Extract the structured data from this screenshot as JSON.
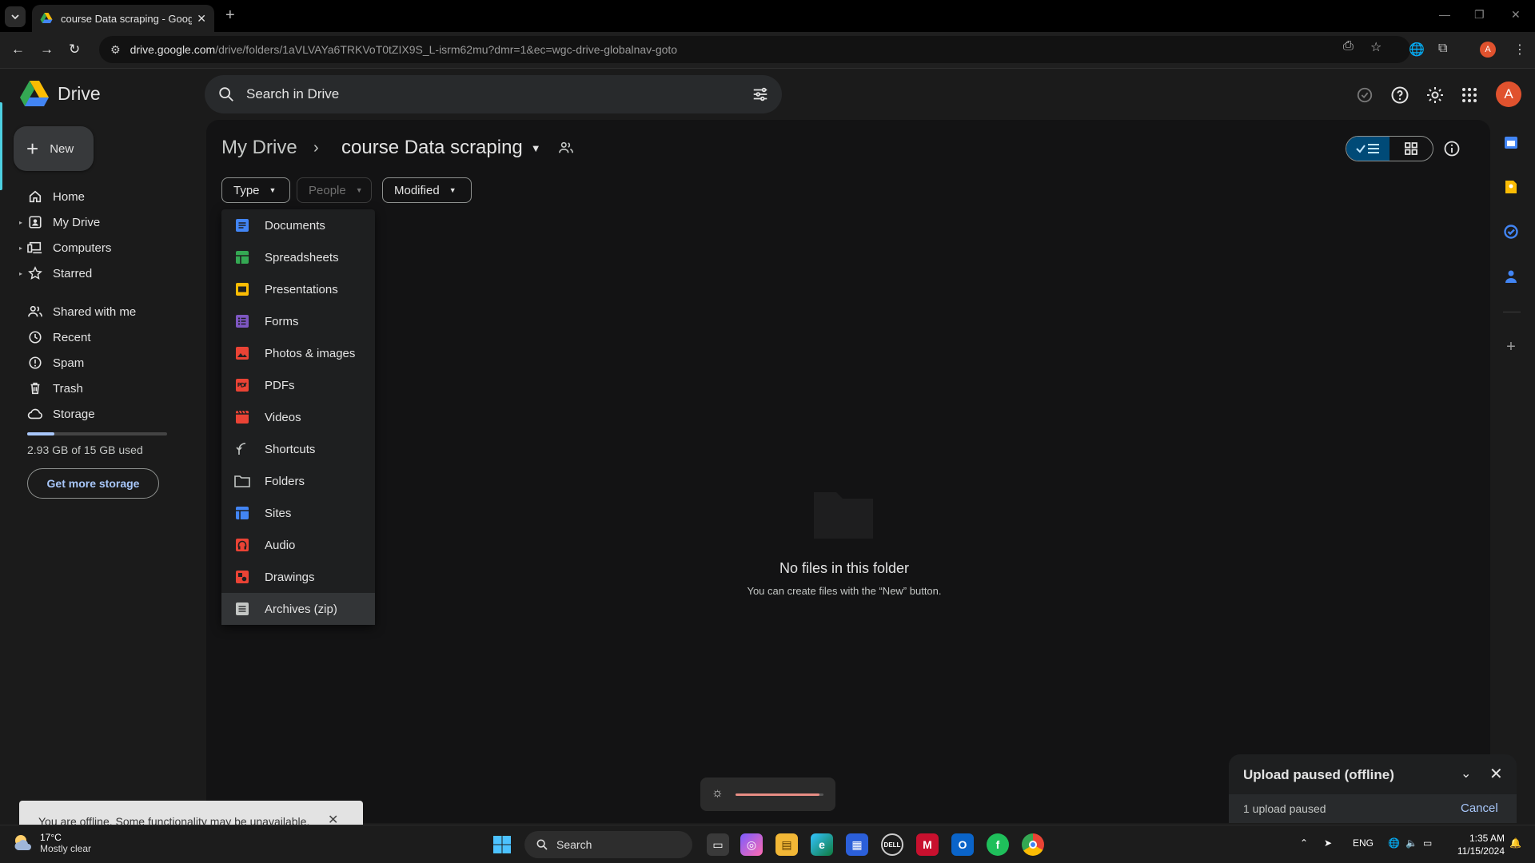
{
  "browser": {
    "tab_title": "course Data scraping - Google Drive",
    "url_host": "drive.google.com",
    "url_path": "/drive/folders/1aVLVAYa6TRKVoT0tZIX9S_L-isrm62mu?dmr=1&ec=wgc-drive-globalnav-goto",
    "profile_initial": "A"
  },
  "drive": {
    "logo_text": "Drive",
    "search_placeholder": "Search in Drive",
    "avatar_initial": "A"
  },
  "sidebar": {
    "new_label": "New",
    "items": [
      {
        "label": "Home",
        "icon": "home-icon"
      },
      {
        "label": "My Drive",
        "icon": "my-drive-icon"
      },
      {
        "label": "Computers",
        "icon": "computers-icon"
      },
      {
        "label": "Starred",
        "icon": "star-icon"
      },
      {
        "label": "Shared with me",
        "icon": "shared-icon"
      },
      {
        "label": "Recent",
        "icon": "clock-icon"
      },
      {
        "label": "Spam",
        "icon": "spam-icon"
      },
      {
        "label": "Trash",
        "icon": "trash-icon"
      },
      {
        "label": "Storage",
        "icon": "cloud-icon"
      }
    ],
    "storage_text": "2.93 GB of 15 GB used",
    "storage_fraction": 0.195,
    "get_more_storage": "Get more storage"
  },
  "main": {
    "breadcrumb_root": "My Drive",
    "breadcrumb_current": "course Data scraping",
    "filters": [
      "Type",
      "People",
      "Modified"
    ],
    "empty_title": "No files in this folder",
    "empty_subtitle": "You can create files with the “New” button."
  },
  "type_menu": {
    "items": [
      {
        "label": "Documents",
        "color": "#4285f4"
      },
      {
        "label": "Spreadsheets",
        "color": "#34a853"
      },
      {
        "label": "Presentations",
        "color": "#fbbc04"
      },
      {
        "label": "Forms",
        "color": "#7e57c2"
      },
      {
        "label": "Photos & images",
        "color": "#ea4335"
      },
      {
        "label": "PDFs",
        "color": "#ea4335"
      },
      {
        "label": "Videos",
        "color": "#ea4335"
      },
      {
        "label": "Shortcuts",
        "color": "#c4c7c5"
      },
      {
        "label": "Folders",
        "color": "#c4c7c5"
      },
      {
        "label": "Sites",
        "color": "#4285f4"
      },
      {
        "label": "Audio",
        "color": "#ea4335"
      },
      {
        "label": "Drawings",
        "color": "#ea4335"
      },
      {
        "label": "Archives (zip)",
        "color": "#c4c7c5"
      }
    ]
  },
  "upload": {
    "title": "Upload paused (offline)",
    "status": "1 upload paused",
    "cancel": "Cancel"
  },
  "snackbar": {
    "message": "You are offline. Some functionality may be unavailable."
  },
  "osd": {
    "brightness_fraction": 0.95
  },
  "taskbar": {
    "temperature": "17°C",
    "weather": "Mostly clear",
    "search_label": "Search",
    "language": "ENG",
    "time": "1:35 AM",
    "date": "11/15/2024"
  }
}
